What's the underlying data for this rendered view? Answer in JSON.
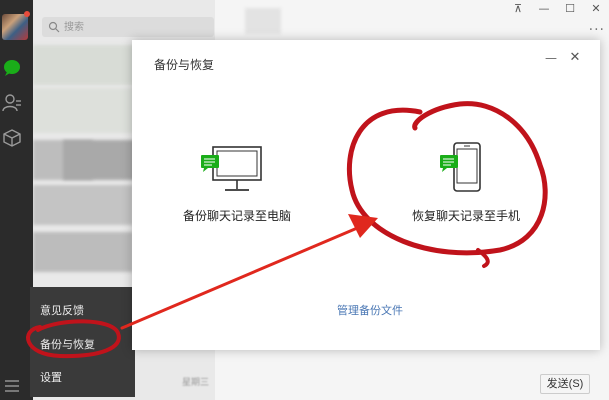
{
  "sidebar": {
    "icons": [
      "avatar",
      "chat-icon",
      "contacts-icon",
      "favorites-icon",
      "menu-icon"
    ],
    "accent": "#1aad19"
  },
  "search": {
    "placeholder": "搜索",
    "add_label": "+"
  },
  "menu": {
    "feedback": "意见反馈",
    "backup": "备份与恢复",
    "settings": "设置"
  },
  "window": {
    "pin": "⊼",
    "minimize": "—",
    "maximize": "☐",
    "close": "✕",
    "more": "···"
  },
  "dialog": {
    "title": "备份与恢复",
    "minimize": "—",
    "close": "✕",
    "backup_to_pc": "备份聊天记录至电脑",
    "restore_to_phone": "恢复聊天记录至手机",
    "manage_files": "管理备份文件"
  },
  "chat": {
    "weekday": "星期三",
    "send_label": "发送(S)"
  },
  "colors": {
    "annotation": "#c0131b",
    "link": "#4a77b4",
    "icon_green": "#1aad19"
  }
}
